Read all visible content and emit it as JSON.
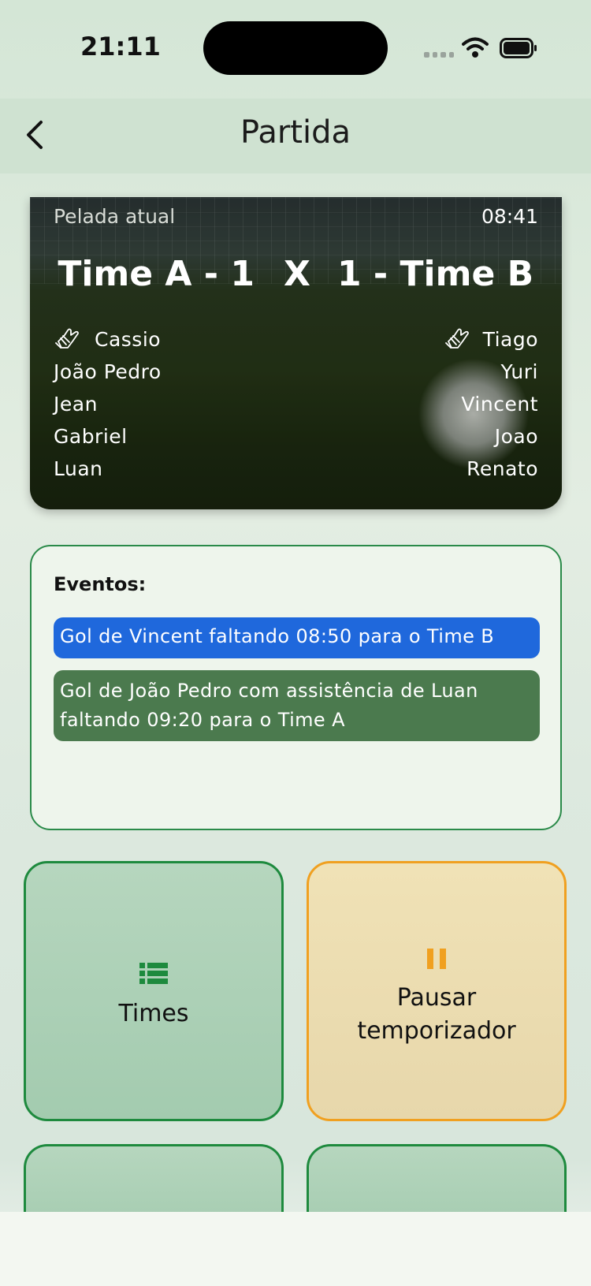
{
  "status_bar": {
    "time": "21:11"
  },
  "nav": {
    "title": "Partida"
  },
  "match": {
    "label": "Pelada atual",
    "clock": "08:41",
    "team_a": "Time A - 1",
    "separator": "X",
    "team_b": "1 - Time B",
    "team_a_players": [
      "Cassio",
      "João Pedro",
      "Jean",
      "Gabriel",
      "Luan"
    ],
    "team_b_players": [
      "Tiago",
      "Yuri",
      "Vincent",
      "Joao",
      "Renato"
    ]
  },
  "events": {
    "title": "Eventos:",
    "items": [
      {
        "text": "Gol de Vincent  faltando 08:50 para o Time B",
        "color": "#1f68dc"
      },
      {
        "text": "Gol de João Pedro com assistência de Luan faltando 09:20 para o Time A",
        "color": "#4b7a4e"
      }
    ]
  },
  "actions": {
    "times": {
      "label": "Times",
      "icon": "list-icon",
      "color": "#1e8a3e"
    },
    "pause": {
      "label_line1": "Pausar",
      "label_line2": "temporizador",
      "icon": "pause-icon",
      "color": "#f0a020"
    }
  }
}
